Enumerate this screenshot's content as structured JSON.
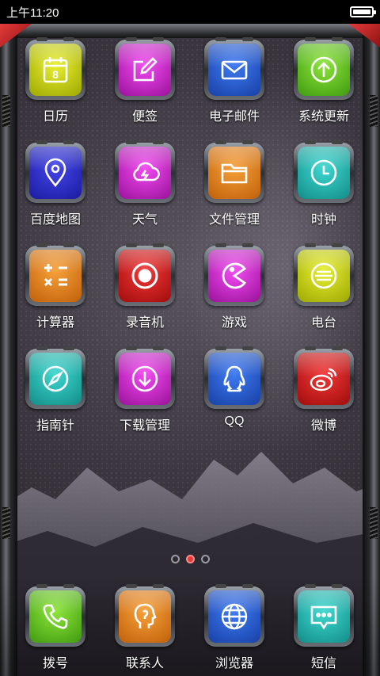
{
  "status_bar": {
    "time": "上午11:20"
  },
  "apps": [
    {
      "label": "日历",
      "icon": "calendar-icon",
      "color": "yellow"
    },
    {
      "label": "便签",
      "icon": "note-icon",
      "color": "magenta"
    },
    {
      "label": "电子邮件",
      "icon": "mail-icon",
      "color": "blue"
    },
    {
      "label": "系统更新",
      "icon": "update-icon",
      "color": "green"
    },
    {
      "label": "百度地图",
      "icon": "map-pin-icon",
      "color": "indigo"
    },
    {
      "label": "天气",
      "icon": "weather-icon",
      "color": "magenta"
    },
    {
      "label": "文件管理",
      "icon": "folder-icon",
      "color": "orange"
    },
    {
      "label": "时钟",
      "icon": "clock-icon",
      "color": "teal"
    },
    {
      "label": "计算器",
      "icon": "calculator-icon",
      "color": "orange"
    },
    {
      "label": "录音机",
      "icon": "record-icon",
      "color": "red"
    },
    {
      "label": "游戏",
      "icon": "game-icon",
      "color": "magenta"
    },
    {
      "label": "电台",
      "icon": "radio-icon",
      "color": "yellow"
    },
    {
      "label": "指南针",
      "icon": "compass-icon",
      "color": "teal"
    },
    {
      "label": "下载管理",
      "icon": "download-icon",
      "color": "magenta"
    },
    {
      "label": "QQ",
      "icon": "qq-icon",
      "color": "blue"
    },
    {
      "label": "微博",
      "icon": "weibo-icon",
      "color": "red"
    }
  ],
  "calendar_day": "8",
  "pager": {
    "pages": 3,
    "active": 2
  },
  "dock": [
    {
      "label": "拨号",
      "icon": "phone-icon",
      "color": "green"
    },
    {
      "label": "联系人",
      "icon": "contacts-icon",
      "color": "orange"
    },
    {
      "label": "浏览器",
      "icon": "browser-icon",
      "color": "blue"
    },
    {
      "label": "短信",
      "icon": "message-icon",
      "color": "teal"
    }
  ],
  "colors": {
    "accent_red": "#e83a3a"
  }
}
